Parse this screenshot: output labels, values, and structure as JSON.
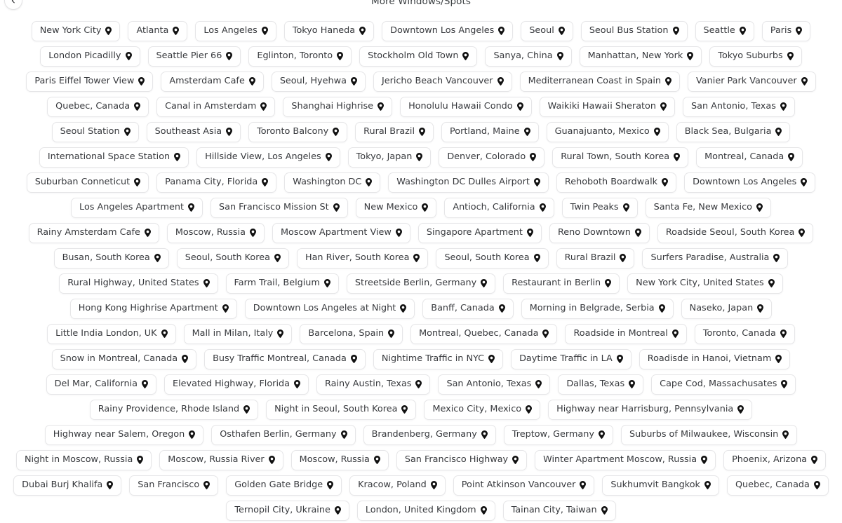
{
  "header": {
    "title": "More Windows/Spots",
    "back_button_label": "Back",
    "back_icon": "chevron-left-icon"
  },
  "pin_icon_name": "map-pin-icon",
  "colors": {
    "page_background": "#ffffff",
    "pill_background": "#ffffff",
    "pill_border": "#e6e6e8",
    "text": "#37393d",
    "title_text": "#3c4043",
    "pin": "#111111"
  },
  "spots": [
    {
      "label": "New York City"
    },
    {
      "label": "Atlanta"
    },
    {
      "label": "Los Angeles"
    },
    {
      "label": "Tokyo Haneda"
    },
    {
      "label": "Downtown Los Angeles"
    },
    {
      "label": "Seoul"
    },
    {
      "label": "Seoul Bus Station"
    },
    {
      "label": "Seattle"
    },
    {
      "label": "Paris"
    },
    {
      "label": "London Picadilly"
    },
    {
      "label": "Seattle Pier 66"
    },
    {
      "label": "Eglinton, Toronto"
    },
    {
      "label": "Stockholm Old Town"
    },
    {
      "label": "Sanya, China"
    },
    {
      "label": "Manhattan, New York"
    },
    {
      "label": "Tokyo Suburbs"
    },
    {
      "label": "Paris Eiffel Tower View"
    },
    {
      "label": "Amsterdam Cafe"
    },
    {
      "label": "Seoul, Hyehwa"
    },
    {
      "label": "Jericho Beach Vancouver"
    },
    {
      "label": "Mediterranean Coast in Spain"
    },
    {
      "label": "Vanier Park Vancouver"
    },
    {
      "label": "Quebec, Canada"
    },
    {
      "label": "Canal in Amsterdam"
    },
    {
      "label": "Shanghai Highrise"
    },
    {
      "label": "Honolulu Hawaii Condo"
    },
    {
      "label": "Waikiki Hawaii Sheraton"
    },
    {
      "label": "San Antonio, Texas"
    },
    {
      "label": "Seoul Station"
    },
    {
      "label": "Southeast Asia"
    },
    {
      "label": "Toronto Balcony"
    },
    {
      "label": "Rural Brazil"
    },
    {
      "label": "Portland, Maine"
    },
    {
      "label": "Guanajuanto, Mexico"
    },
    {
      "label": "Black Sea, Bulgaria"
    },
    {
      "label": "International Space Station"
    },
    {
      "label": "Hillside View, Los Angeles"
    },
    {
      "label": "Tokyo, Japan"
    },
    {
      "label": "Denver, Colorado"
    },
    {
      "label": "Rural Town, South Korea"
    },
    {
      "label": "Montreal, Canada"
    },
    {
      "label": "Suburban Conneticut"
    },
    {
      "label": "Panama City, Florida"
    },
    {
      "label": "Washington DC"
    },
    {
      "label": "Washington DC Dulles Airport"
    },
    {
      "label": "Rehoboth Boardwalk"
    },
    {
      "label": "Downtown Los Angeles"
    },
    {
      "label": "Los Angeles Apartment"
    },
    {
      "label": "San Francisco Mission St"
    },
    {
      "label": "New Mexico"
    },
    {
      "label": "Antioch, California"
    },
    {
      "label": "Twin Peaks"
    },
    {
      "label": "Santa Fe, New Mexico"
    },
    {
      "label": "Rainy Amsterdam Cafe"
    },
    {
      "label": "Moscow, Russia"
    },
    {
      "label": "Moscow Apartment View"
    },
    {
      "label": "Singapore Apartment"
    },
    {
      "label": "Reno Downtown"
    },
    {
      "label": "Roadside Seoul, South Korea"
    },
    {
      "label": "Busan, South Korea"
    },
    {
      "label": "Seoul, South Korea"
    },
    {
      "label": "Han River, South Korea"
    },
    {
      "label": "Seoul, South Korea"
    },
    {
      "label": "Rural Brazil"
    },
    {
      "label": "Surfers Paradise, Australia"
    },
    {
      "label": "Rural Highway, United States"
    },
    {
      "label": "Farm Trail, Belgium"
    },
    {
      "label": "Streetside Berlin, Germany"
    },
    {
      "label": "Restaurant in Berlin"
    },
    {
      "label": "New York City, United States"
    },
    {
      "label": "Hong Kong Highrise Apartment"
    },
    {
      "label": "Downtown Los Angeles at Night"
    },
    {
      "label": "Banff, Canada"
    },
    {
      "label": "Morning in Belgrade, Serbia"
    },
    {
      "label": "Naseko, Japan"
    },
    {
      "label": "Little India London, UK"
    },
    {
      "label": "Mall in Milan, Italy"
    },
    {
      "label": "Barcelona, Spain"
    },
    {
      "label": "Montreal, Quebec, Canada"
    },
    {
      "label": "Roadside in Montreal"
    },
    {
      "label": "Toronto, Canada"
    },
    {
      "label": "Snow in Montreal, Canada"
    },
    {
      "label": "Busy Traffic Montreal, Canada"
    },
    {
      "label": "Nightime Traffic in NYC"
    },
    {
      "label": "Daytime Traffic in LA"
    },
    {
      "label": "Roadisde in Hanoi, Vietnam"
    },
    {
      "label": "Del Mar, California"
    },
    {
      "label": "Elevated Highway, Florida"
    },
    {
      "label": "Rainy Austin, Texas"
    },
    {
      "label": "San Antonio, Texas"
    },
    {
      "label": "Dallas, Texas"
    },
    {
      "label": "Cape Cod, Massachusates"
    },
    {
      "label": "Rainy Providence, Rhode Island"
    },
    {
      "label": "Night in Seoul, South Korea"
    },
    {
      "label": "Mexico City, Mexico"
    },
    {
      "label": "Highway near Harrisburg, Pennsylvania"
    },
    {
      "label": "Highway near Salem, Oregon"
    },
    {
      "label": "Osthafen Berlin, Germany"
    },
    {
      "label": "Brandenberg, Germany"
    },
    {
      "label": "Treptow, Germany"
    },
    {
      "label": "Suburbs of Milwaukee, Wisconsin"
    },
    {
      "label": "Night in Moscow, Russia"
    },
    {
      "label": "Moscow, Russia River"
    },
    {
      "label": "Moscow, Russia"
    },
    {
      "label": "San Francisco Highway"
    },
    {
      "label": "Winter Apartment Moscow, Russia"
    },
    {
      "label": "Phoenix, Arizona"
    },
    {
      "label": "Dubai Burj Khalifa"
    },
    {
      "label": "San Francisco"
    },
    {
      "label": "Golden Gate Bridge"
    },
    {
      "label": "Kracow, Poland"
    },
    {
      "label": "Point Atkinson Vancouver"
    },
    {
      "label": "Sukhumvit Bangkok"
    },
    {
      "label": "Quebec, Canada"
    },
    {
      "label": "Ternopil City, Ukraine"
    },
    {
      "label": "London, United Kingdom"
    },
    {
      "label": "Tainan City, Taiwan"
    }
  ]
}
